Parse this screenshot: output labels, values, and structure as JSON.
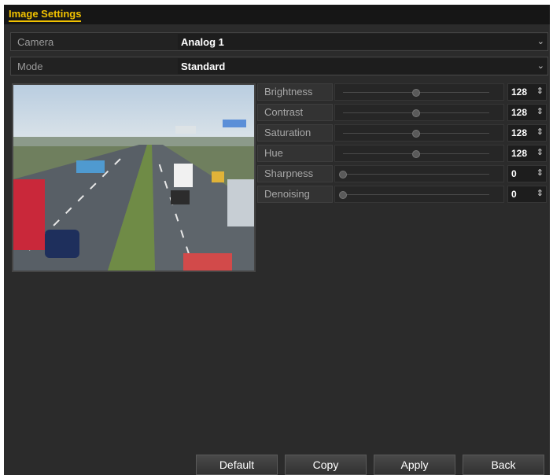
{
  "window": {
    "title": "Image Settings"
  },
  "camera": {
    "label": "Camera",
    "value": "Analog 1",
    "caret": "⌄"
  },
  "mode": {
    "label": "Mode",
    "value": "Standard",
    "caret": "⌄"
  },
  "adjustments": [
    {
      "label": "Brightness",
      "value": "128",
      "level": 0.5
    },
    {
      "label": "Contrast",
      "value": "128",
      "level": 0.5
    },
    {
      "label": "Saturation",
      "value": "128",
      "level": 0.5
    },
    {
      "label": "Hue",
      "value": "128",
      "level": 0.5
    },
    {
      "label": "Sharpness",
      "value": "0",
      "level": 0
    },
    {
      "label": "Denoising",
      "value": "0",
      "level": 0
    }
  ],
  "spin_icon": "⇕",
  "buttons": {
    "default": "Default",
    "copy": "Copy",
    "apply": "Apply",
    "back": "Back"
  },
  "colors": {
    "title_accent": "#f2c200",
    "panel": "#2b2b2b"
  }
}
